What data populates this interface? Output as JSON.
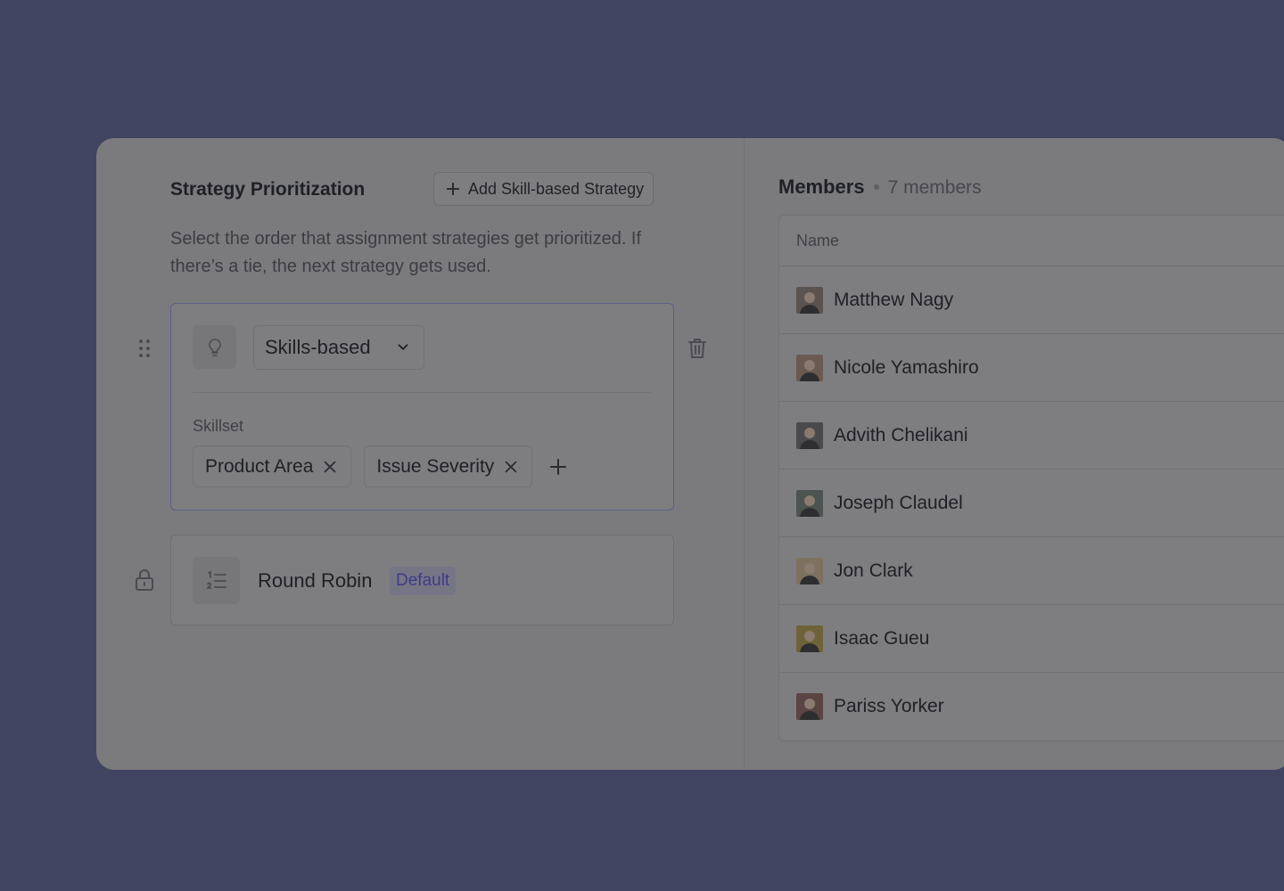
{
  "strategy": {
    "title": "Strategy Prioritization",
    "add_button_label": "Add Skill-based Strategy",
    "description": "Select the order that assignment strategies get prioritized. If there’s a tie, the next strategy gets used.",
    "items": [
      {
        "type_label": "Skills-based",
        "icon": "lightbulb-icon",
        "skillset_label": "Skillset",
        "skills": [
          "Product Area",
          "Issue Severity"
        ]
      },
      {
        "type_label": "Round Robin",
        "icon": "numbered-list-icon",
        "badge": "Default"
      }
    ]
  },
  "members": {
    "title": "Members",
    "count_label": "7 members",
    "column_name": "Name",
    "list": [
      {
        "name": "Matthew Nagy",
        "color": "#5b5350"
      },
      {
        "name": "Nicole Yamashiro",
        "color": "#6a5a52"
      },
      {
        "name": "Advith Chelikani",
        "color": "#4a4a4c"
      },
      {
        "name": "Joseph Claudel",
        "color": "#4d5350"
      },
      {
        "name": "Jon Clark",
        "color": "#7d7260"
      },
      {
        "name": "Isaac Gueu",
        "color": "#6e6338"
      },
      {
        "name": "Pariss Yorker",
        "color": "#5a4444"
      }
    ]
  },
  "colors": {
    "backdrop": "#414460",
    "accent": "#3d3c86"
  }
}
